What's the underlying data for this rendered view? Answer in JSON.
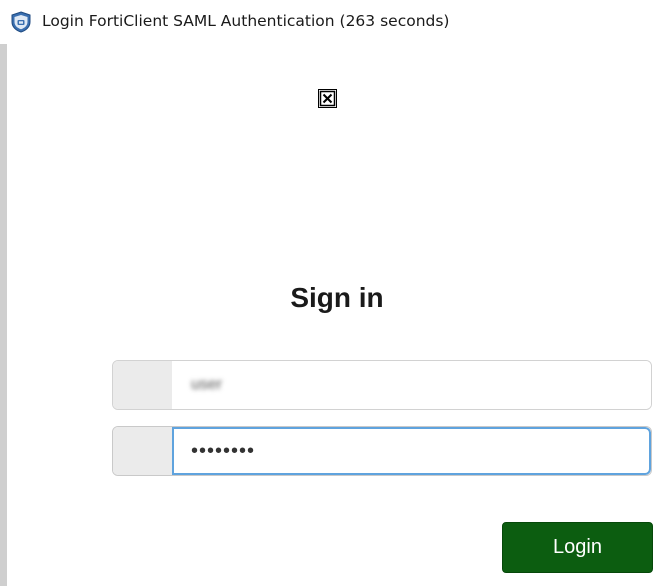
{
  "window": {
    "title": "Login FortiClient SAML Authentication (263 seconds)",
    "icon": "forticlient-shield-icon"
  },
  "page": {
    "broken_image_icon": "broken-image-icon",
    "heading": "Sign in"
  },
  "form": {
    "username": {
      "value": "user",
      "blurred": true
    },
    "password": {
      "value": "••••••••",
      "focused": true
    },
    "login_label": "Login"
  },
  "colors": {
    "login_button": "#0c5d10",
    "focus_border": "#5fa3de",
    "addon_background": "#ebebeb",
    "left_border": "#cfcfcf"
  }
}
